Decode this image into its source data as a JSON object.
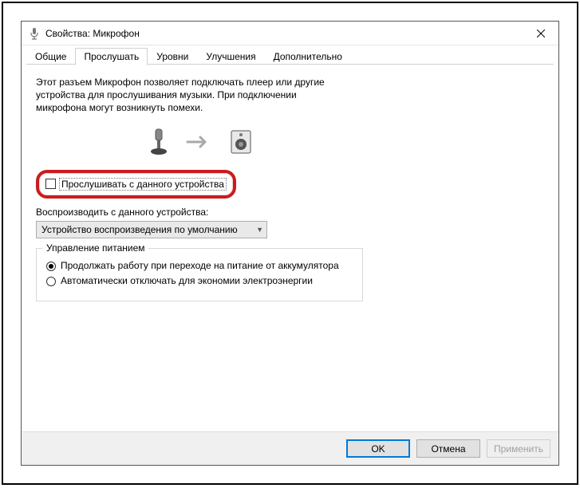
{
  "window": {
    "title": "Свойства: Микрофон"
  },
  "tabs": {
    "general": "Общие",
    "listen": "Прослушать",
    "levels": "Уровни",
    "enhancements": "Улучшения",
    "advanced": "Дополнительно"
  },
  "listen": {
    "description": "Этот разъем Микрофон позволяет подключать плеер или другие устройства для прослушивания музыки. При подключении микрофона могут возникнуть помехи.",
    "listen_checkbox_label": "Прослушивать с данного устройства",
    "playback_label": "Воспроизводить с данного устройства:",
    "playback_combo_value": "Устройство воспроизведения по умолчанию",
    "power_group": "Управление питанием",
    "power_continue": "Продолжать работу при переходе на питание от аккумулятора",
    "power_auto_off": "Автоматически отключать для экономии электроэнергии"
  },
  "buttons": {
    "ok": "OK",
    "cancel": "Отмена",
    "apply": "Применить"
  }
}
